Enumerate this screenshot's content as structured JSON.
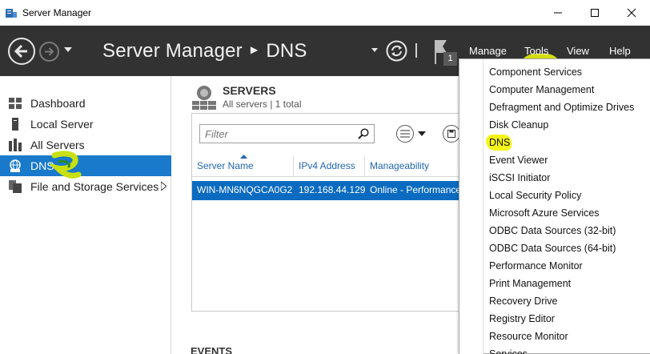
{
  "window": {
    "title": "Server Manager"
  },
  "cmdbar": {
    "breadcrumb_root": "Server Manager",
    "breadcrumb_current": "DNS",
    "flag_count": "1",
    "menus": {
      "manage": "Manage",
      "tools": "Tools",
      "view": "View",
      "help": "Help"
    }
  },
  "sidebar": {
    "items": [
      {
        "label": "Dashboard"
      },
      {
        "label": "Local Server"
      },
      {
        "label": "All Servers"
      },
      {
        "label": "DNS"
      },
      {
        "label": "File and Storage Services"
      }
    ]
  },
  "servers": {
    "title": "SERVERS",
    "subtitle": "All servers | 1 total",
    "filter_placeholder": "Filter",
    "columns": [
      "Server Name",
      "IPv4 Address",
      "Manageability"
    ],
    "rows": [
      {
        "name": "WIN-MN6NQGCA0G2",
        "ip": "192.168.44.129",
        "manageability": "Online - Performance"
      }
    ]
  },
  "events": {
    "title": "EVENTS"
  },
  "tools_menu": {
    "items": [
      "Component Services",
      "Computer Management",
      "Defragment and Optimize Drives",
      "Disk Cleanup",
      "DNS",
      "Event Viewer",
      "iSCSI Initiator",
      "Local Security Policy",
      "Microsoft Azure Services",
      "ODBC Data Sources (32-bit)",
      "ODBC Data Sources (64-bit)",
      "Performance Monitor",
      "Print Management",
      "Recovery Drive",
      "Registry Editor",
      "Resource Monitor",
      "Services"
    ]
  },
  "colors": {
    "accent": "#1979ca",
    "command_bar": "#323232",
    "selection": "#0a6bc0",
    "highlight_yellow": "#f4f41a"
  }
}
